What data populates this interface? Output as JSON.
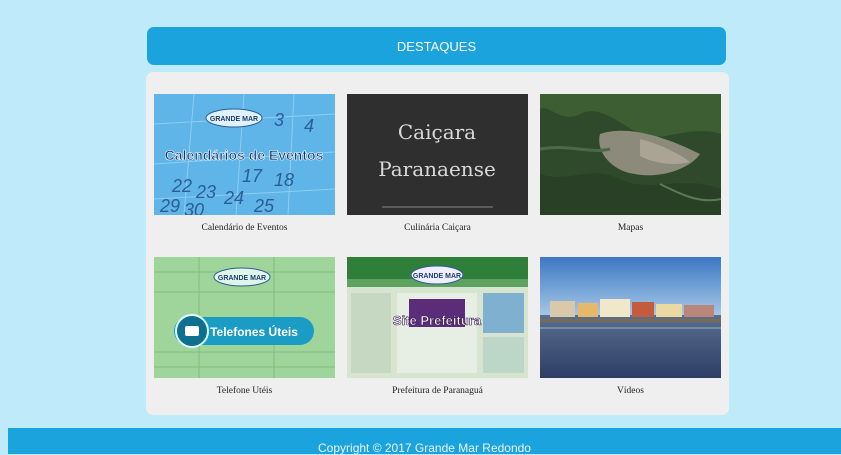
{
  "header": {
    "title": "DESTAQUES"
  },
  "cards": [
    {
      "caption": "Calendário de Eventos",
      "overlay": "Calendários de Eventos",
      "brand": "GRANDE MAR"
    },
    {
      "caption": "Culinária Caiçara",
      "overlay_line1": "Caiçara",
      "overlay_line2": "Paranaense"
    },
    {
      "caption": "Mapas"
    },
    {
      "caption": "Telefone Utéis",
      "overlay": "Telefones Úteis",
      "brand": "GRANDE MAR"
    },
    {
      "caption": "Prefeitura de Paranaguá",
      "overlay": "Site Prefeitura",
      "brand": "GRANDE MAR"
    },
    {
      "caption": "Vídeos"
    }
  ],
  "footer": {
    "text": "Copyright © 2017 Grande Mar Redondo"
  },
  "colors": {
    "accent": "#1aa3dc",
    "background": "#bfeaf9",
    "panel": "#efefef"
  }
}
